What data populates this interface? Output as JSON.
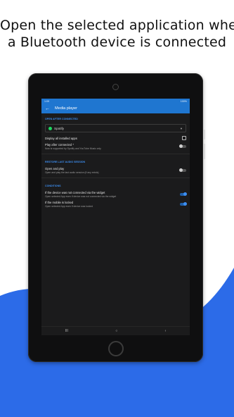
{
  "headline": {
    "line1": "Open the selected application when",
    "line2": "a Bluetooth device is connected"
  },
  "colors": {
    "accent": "#1f76d0",
    "wave": "#2c6be8",
    "spotify": "#1ed760"
  },
  "status_bar": {
    "time": "1:09",
    "right": "100%"
  },
  "app_bar": {
    "back_icon": "arrow-back-icon",
    "title": "Media player"
  },
  "sections": {
    "open_after": "OPEN AFTER CONNECTED",
    "restore": "RESTORE LAST AUDIO SESSION",
    "conditions": "CONDITIONS"
  },
  "dropdown": {
    "selected": "Spotify"
  },
  "options": {
    "display_all": {
      "title": "Display all installed apps",
      "checked": false
    },
    "play_after": {
      "title": "Play after connected *",
      "subtitle": "Now is supported by Spotify and YouTube Music only",
      "on": false
    },
    "open_and_play": {
      "title": "Open and play",
      "subtitle": "Open and play the last audio session (if any exists)",
      "on": false
    },
    "not_connected_widget": {
      "title": "If the device was not connected via the widget",
      "subtitle": "Open selected App even if device was not connected via the widget",
      "on": true
    },
    "mobile_locked": {
      "title": "If the mobile is locked",
      "subtitle": "Open selected App even if device was locked",
      "on": true
    }
  },
  "nav_bar": {
    "recents": "III",
    "home": "○",
    "back": "‹"
  }
}
